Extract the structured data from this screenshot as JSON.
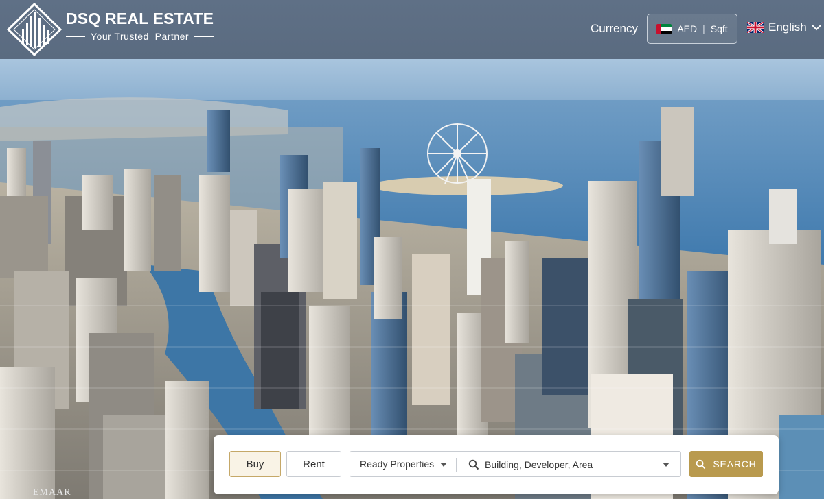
{
  "header": {
    "brand_name": "DSQ REAL ESTATE",
    "tagline": "Your Trusted  Partner",
    "currency_label": "Currency",
    "currency": {
      "code": "AED",
      "unit": "Sqft",
      "separator": "|"
    },
    "language": "English"
  },
  "search": {
    "tabs": [
      {
        "label": "Buy",
        "active": true
      },
      {
        "label": "Rent",
        "active": false
      }
    ],
    "property_type": "Ready Properties",
    "placeholder": "Building, Developer, Area",
    "button_label": "SEARCH"
  },
  "hero": {
    "signage": "EMAAR"
  },
  "colors": {
    "header_bg": "#5e6f83",
    "accent_gold": "#b99a4e",
    "buy_tab_bg": "#f9f3e6"
  }
}
